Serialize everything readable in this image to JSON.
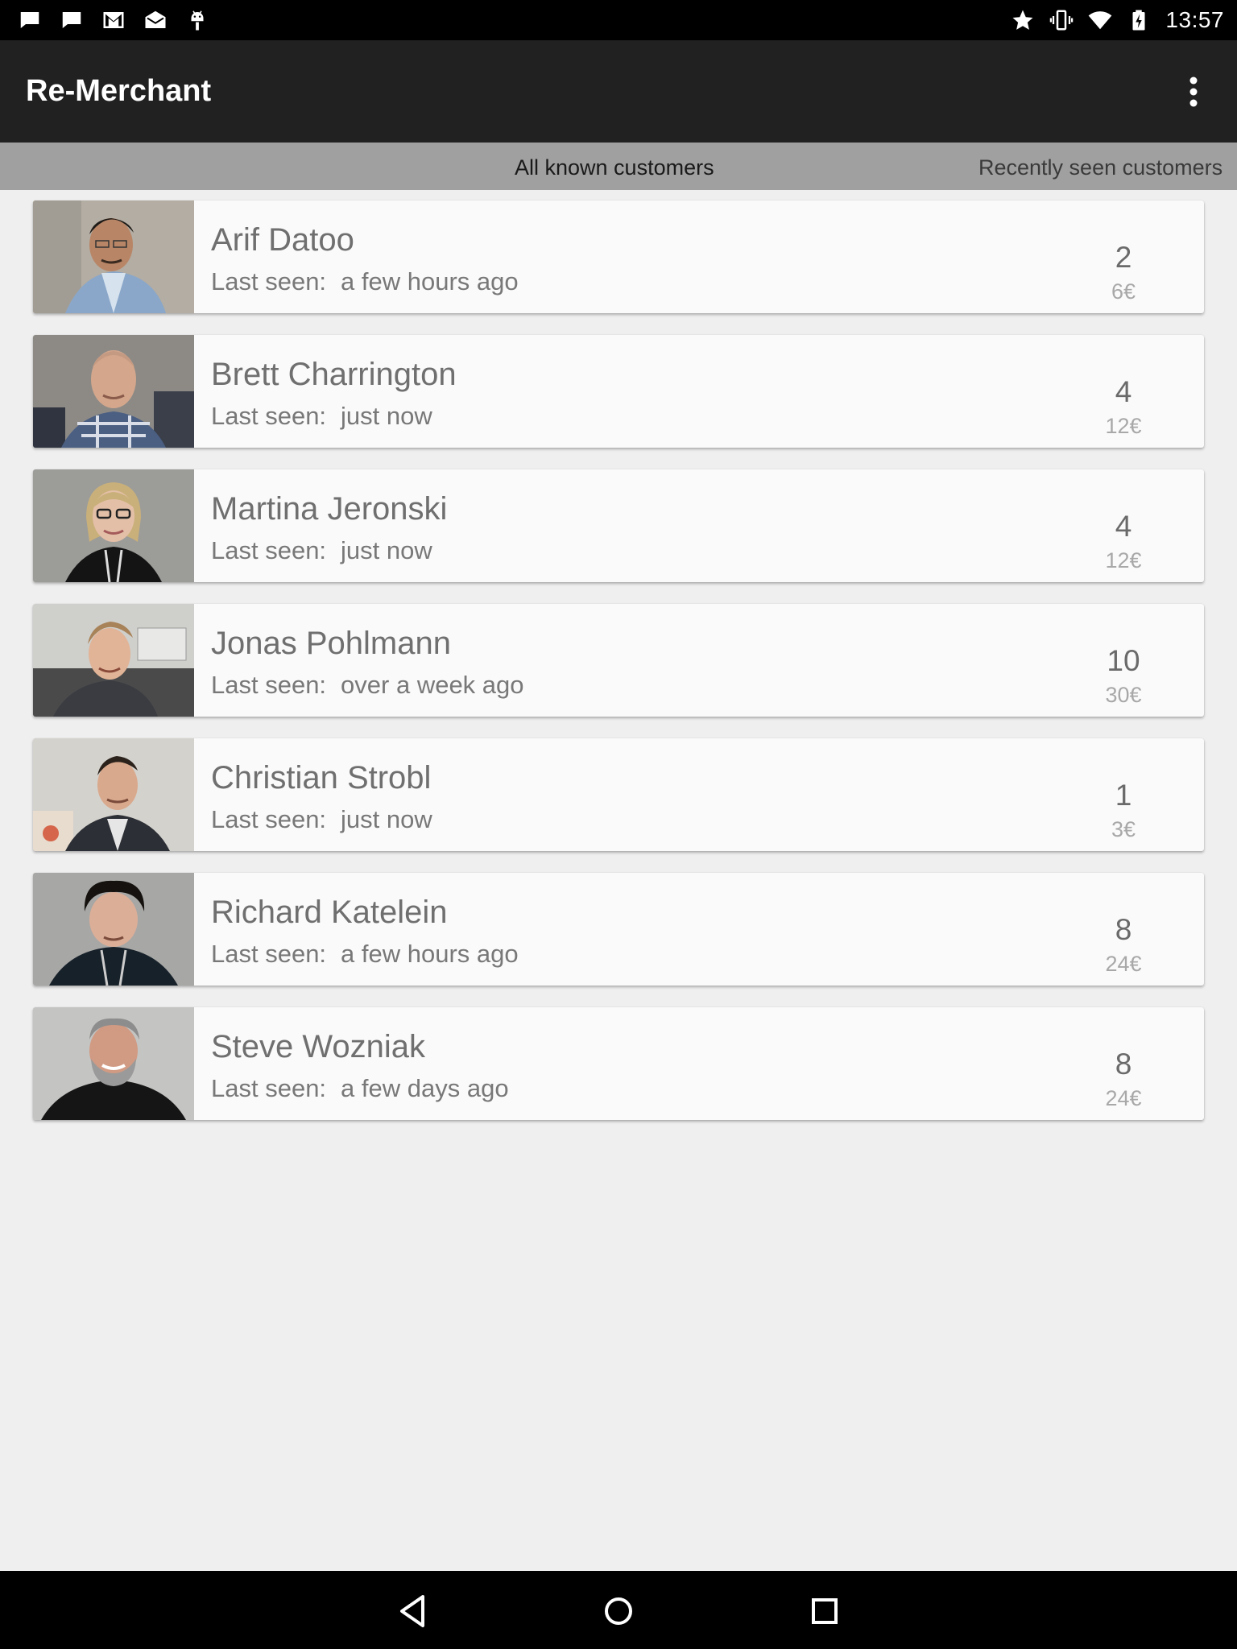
{
  "status_bar": {
    "left_icons": [
      "chat-icon",
      "chat-icon",
      "gmail-icon",
      "mail-icon",
      "android-icon"
    ],
    "right_icons": [
      "star-icon",
      "vibrate-icon",
      "wifi-icon",
      "battery-charging-icon"
    ],
    "time": "13:57"
  },
  "app_bar": {
    "title": "Re-Merchant",
    "overflow_icon": "more-vert-icon"
  },
  "tabs": [
    {
      "label": "All known customers",
      "selected": true
    },
    {
      "label": "Recently seen customers",
      "selected": false
    }
  ],
  "customers": [
    {
      "name": "Arif Datoo",
      "last_seen_label": "Last seen:",
      "last_seen": "a few hours ago",
      "count": "2",
      "amount": "6€"
    },
    {
      "name": "Brett Charrington",
      "last_seen_label": "Last seen:",
      "last_seen": "just now",
      "count": "4",
      "amount": "12€"
    },
    {
      "name": "Martina Jeronski",
      "last_seen_label": "Last seen:",
      "last_seen": "just now",
      "count": "4",
      "amount": "12€"
    },
    {
      "name": "Jonas Pohlmann",
      "last_seen_label": "Last seen:",
      "last_seen": "over a week ago",
      "count": "10",
      "amount": "30€"
    },
    {
      "name": "Christian Strobl",
      "last_seen_label": "Last seen:",
      "last_seen": "just now",
      "count": "1",
      "amount": "3€"
    },
    {
      "name": "Richard Katelein",
      "last_seen_label": "Last seen:",
      "last_seen": "a few hours ago",
      "count": "8",
      "amount": "24€"
    },
    {
      "name": "Steve Wozniak",
      "last_seen_label": "Last seen:",
      "last_seen": "a few days ago",
      "count": "8",
      "amount": "24€"
    }
  ],
  "nav_bar": {
    "buttons": [
      "back-icon",
      "home-icon",
      "recents-icon"
    ]
  },
  "colors": {
    "status_bar": "#000000",
    "app_bar": "#212121",
    "tab_strip": "#a0a0a0",
    "background": "#efefef",
    "card": "#fafafa"
  }
}
